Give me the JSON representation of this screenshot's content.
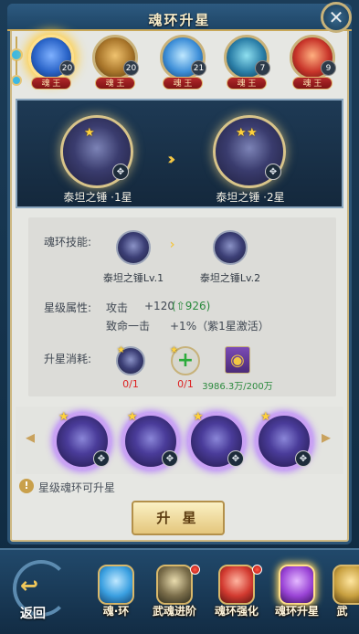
{
  "window": {
    "title": "魂环升星"
  },
  "top_rings": [
    {
      "level": "20",
      "tag": "魂 王",
      "color": "#2a64c8",
      "selected": true
    },
    {
      "level": "20",
      "tag": "魂 王",
      "color": "#a8752a",
      "selected": false
    },
    {
      "level": "21",
      "tag": "魂 王",
      "color": "#3e8fd8",
      "selected": false
    },
    {
      "level": "7",
      "tag": "魂 王",
      "color": "#2b7fa8",
      "selected": false
    },
    {
      "level": "9",
      "tag": "魂 王",
      "color": "#c8352a",
      "selected": false
    }
  ],
  "preview": {
    "from_label": "泰坦之锤 ·1星",
    "to_label": "泰坦之锤 ·2星",
    "from_stars": 1,
    "to_stars": 2
  },
  "skill": {
    "label": "魂环技能:",
    "from": "泰坦之锤Lv.1",
    "to": "泰坦之锤Lv.2"
  },
  "attributes": {
    "label": "星级属性:",
    "attack_label": "攻击",
    "attack_value": "+120",
    "attack_power": "926",
    "crit_label": "致命一击",
    "crit_value": "+1%（紫1星激活）"
  },
  "cost": {
    "label": "升星消耗:",
    "item1_count": "0/1",
    "item2_count": "0/1",
    "gold_count": "3986.3万/200万"
  },
  "hint": "星级魂环可升星",
  "upgrade_button": "升 星",
  "bottom_nav": {
    "back": "返回",
    "items": [
      {
        "label": "魂·环",
        "color": "#3a9fe0",
        "dot": false
      },
      {
        "label": "武魂进阶",
        "color": "#7a6d4a",
        "dot": true
      },
      {
        "label": "魂环强化",
        "color": "#d23a30",
        "dot": true
      },
      {
        "label": "魂环升星",
        "color": "#9a44d6",
        "dot": false
      },
      {
        "label": "武",
        "color": "#c8a040",
        "dot": false
      }
    ]
  },
  "colors": {
    "accent_gold": "#d8c48a",
    "panel_bg": "#e6e7e3",
    "frame_blue": "#1e4566",
    "power_green": "#2b8a3e"
  }
}
